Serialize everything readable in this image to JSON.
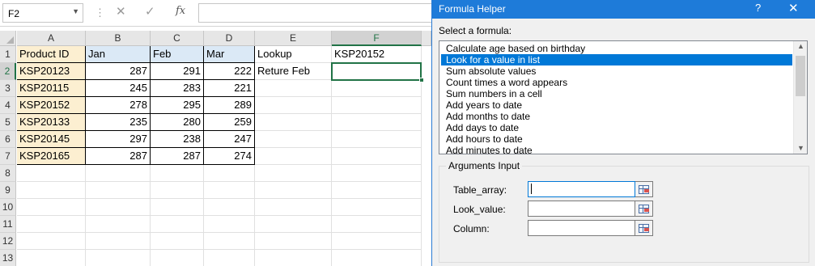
{
  "formula_bar": {
    "name_box": "F2",
    "cancel_glyph": "✕",
    "enter_glyph": "✓",
    "fx_label": "fx",
    "formula": ""
  },
  "sheet": {
    "columns": [
      "A",
      "B",
      "C",
      "D",
      "E",
      "F"
    ],
    "rows": [
      "1",
      "2",
      "3",
      "4",
      "5",
      "6",
      "7",
      "8",
      "9",
      "10",
      "11",
      "12",
      "13"
    ],
    "active_cell": "F2",
    "cells": {
      "A1": "Product ID",
      "B1": "Jan",
      "C1": "Feb",
      "D1": "Mar",
      "E1": "Lookup",
      "F1": "KSP20152",
      "A2": "KSP20123",
      "B2": "287",
      "C2": "291",
      "D2": "222",
      "E2": "Reture Feb",
      "A3": "KSP20115",
      "B3": "245",
      "C3": "283",
      "D3": "221",
      "A4": "KSP20152",
      "B4": "278",
      "C4": "295",
      "D4": "289",
      "A5": "KSP20133",
      "B5": "235",
      "C5": "280",
      "D5": "259",
      "A6": "KSP20145",
      "B6": "297",
      "C6": "238",
      "D6": "247",
      "A7": "KSP20165",
      "B7": "287",
      "C7": "287",
      "D7": "274"
    },
    "colors": {
      "id_fill": "#fcefd1",
      "month_fill": "#dbe9f6",
      "selection": "#217346"
    }
  },
  "dialog": {
    "title": "Formula Helper",
    "help": "?",
    "close": "✕",
    "select_label": "Select a formula:",
    "formulas": [
      "Calculate age based on birthday",
      "Look for a value in list",
      "Sum absolute values",
      "Count times a word appears",
      "Sum numbers in a cell",
      "Add years to date",
      "Add months to date",
      "Add days to date",
      "Add hours to date",
      "Add minutes to date"
    ],
    "selected_index": 1,
    "args_title": "Arguments Input",
    "args": [
      {
        "label": "Table_array:",
        "value": ""
      },
      {
        "label": "Look_value:",
        "value": ""
      },
      {
        "label": "Column:",
        "value": ""
      }
    ],
    "colors": {
      "title_bar": "#1e7bd9",
      "list_selection": "#0078d7"
    }
  }
}
